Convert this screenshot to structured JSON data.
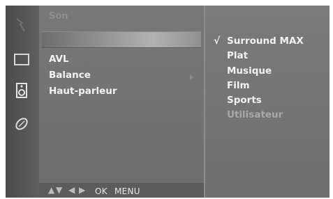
{
  "menu": {
    "title": "Son",
    "items": [
      {
        "label": "AVL"
      },
      {
        "label": "Balance"
      },
      {
        "label": "Haut-parleur"
      }
    ]
  },
  "nav": {
    "ok_label": "OK",
    "menu_label": "MENU"
  },
  "options": {
    "selected_mark": "√",
    "items": [
      {
        "label": "Surround MAX",
        "selected": true
      },
      {
        "label": "Plat"
      },
      {
        "label": "Musique"
      },
      {
        "label": "Film"
      },
      {
        "label": "Sports"
      },
      {
        "label": "Utilisateur",
        "dimmed": true
      }
    ]
  },
  "sidebar_icons": [
    "input-icon",
    "picture-icon",
    "audio-icon",
    "setup-icon"
  ],
  "colors": {
    "background": "#6a6a6a",
    "text": "#f2f2f2",
    "dim_text": "#a8a8a8"
  }
}
